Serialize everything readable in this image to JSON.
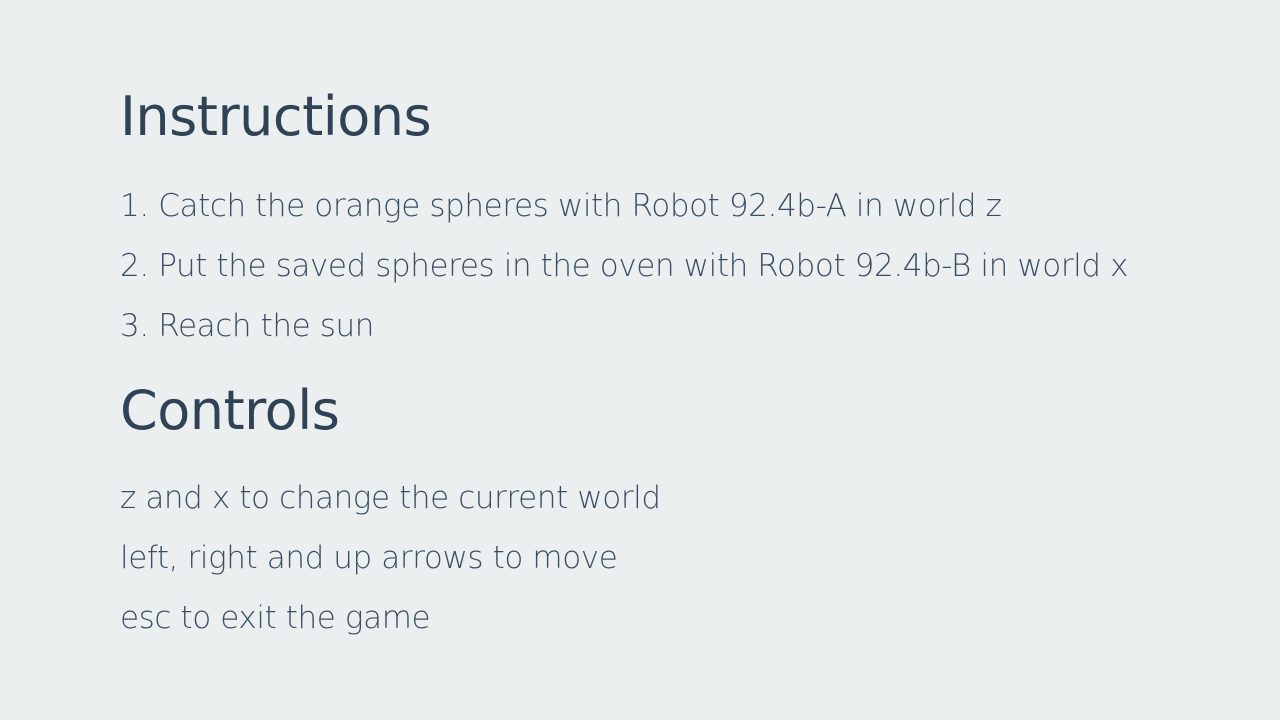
{
  "instructions": {
    "title": "Instructions",
    "steps": [
      "1. Catch the orange spheres with Robot 92.4b-A in world z",
      "2. Put the saved spheres in the oven with Robot 92.4b-B in world x",
      "3. Reach the sun"
    ]
  },
  "controls": {
    "title": "Controls",
    "items": [
      "z and x to change the current world",
      "left, right and up arrows to move",
      "esc to exit the game"
    ]
  },
  "colors": {
    "background": "#ebeff0",
    "text": "#34495e"
  }
}
